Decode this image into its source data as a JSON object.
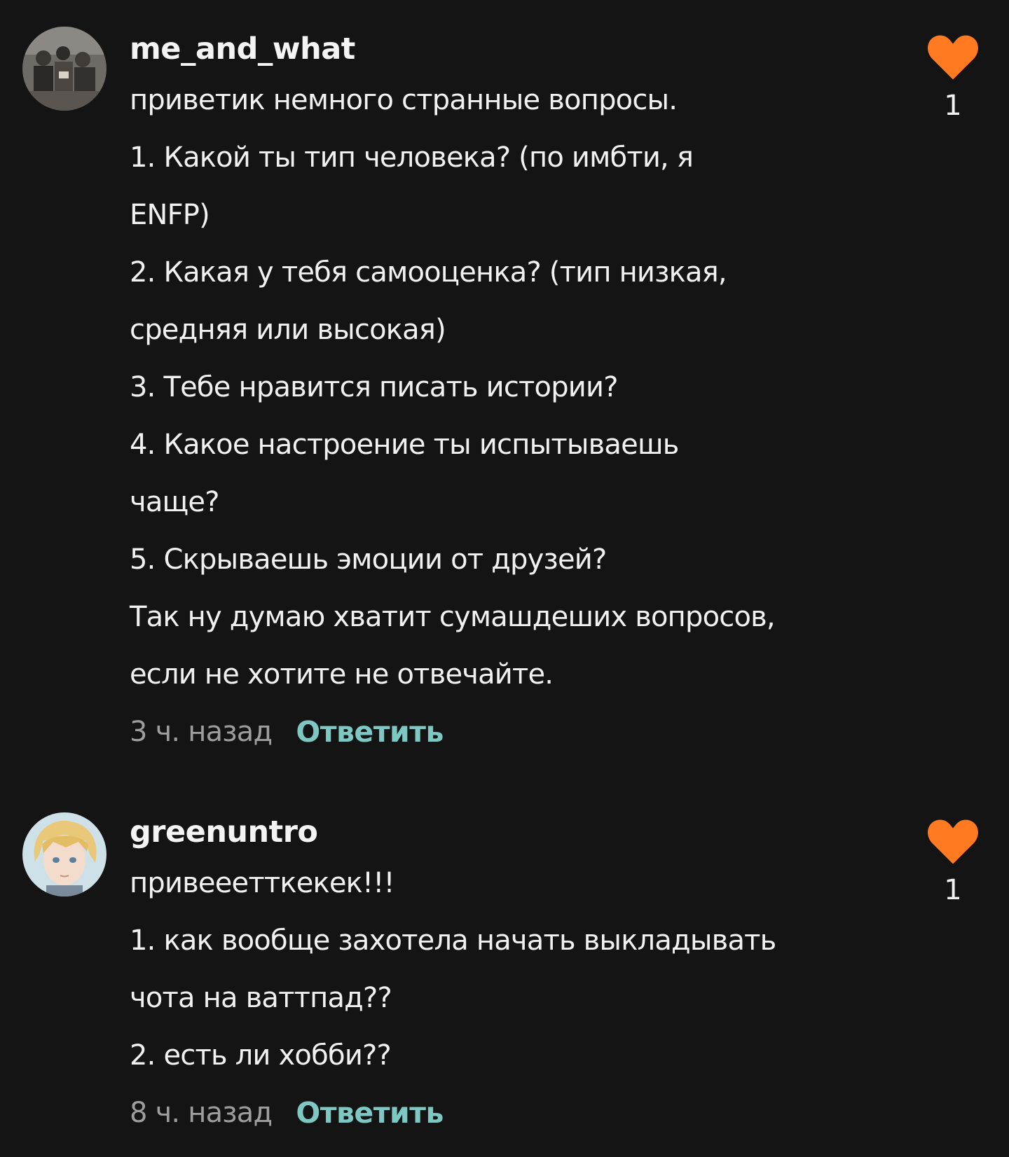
{
  "colors": {
    "background": "#141414",
    "text": "#f2f2f2",
    "muted": "#9e9e9e",
    "reply_accent": "#7ec8c3",
    "like_accent": "#ff7a21"
  },
  "comments": [
    {
      "username": "me_and_what",
      "avatar_icon": "group-photo-avatar",
      "lines": [
        "приветик немного странные вопросы.",
        "1. Какой ты тип человека? (по имбти, я",
        "ENFP)",
        "2. Какая у тебя самооценка? (тип низкая,",
        "средняя или высокая)",
        "3. Тебе нравится писать истории?",
        "4.  Какое настроение ты испытываешь",
        "чаще?",
        "5. Скрываешь эмоции от друзей?",
        "Так ну думаю хватит сумашдеших вопросов,",
        "если не хотите не отвечайте."
      ],
      "time": "3 ч. назад",
      "reply_label": "Ответить",
      "like_icon": "heart-icon",
      "likes": "1"
    },
    {
      "username": "greenuntro",
      "avatar_icon": "anime-character-avatar",
      "lines": [
        "привееетткекек!!!",
        "1. как вообще захотела начать выкладывать",
        "чота на ваттпад??",
        "2. есть ли хобби??"
      ],
      "time": "8 ч. назад",
      "reply_label": "Ответить",
      "like_icon": "heart-icon",
      "likes": "1"
    }
  ]
}
